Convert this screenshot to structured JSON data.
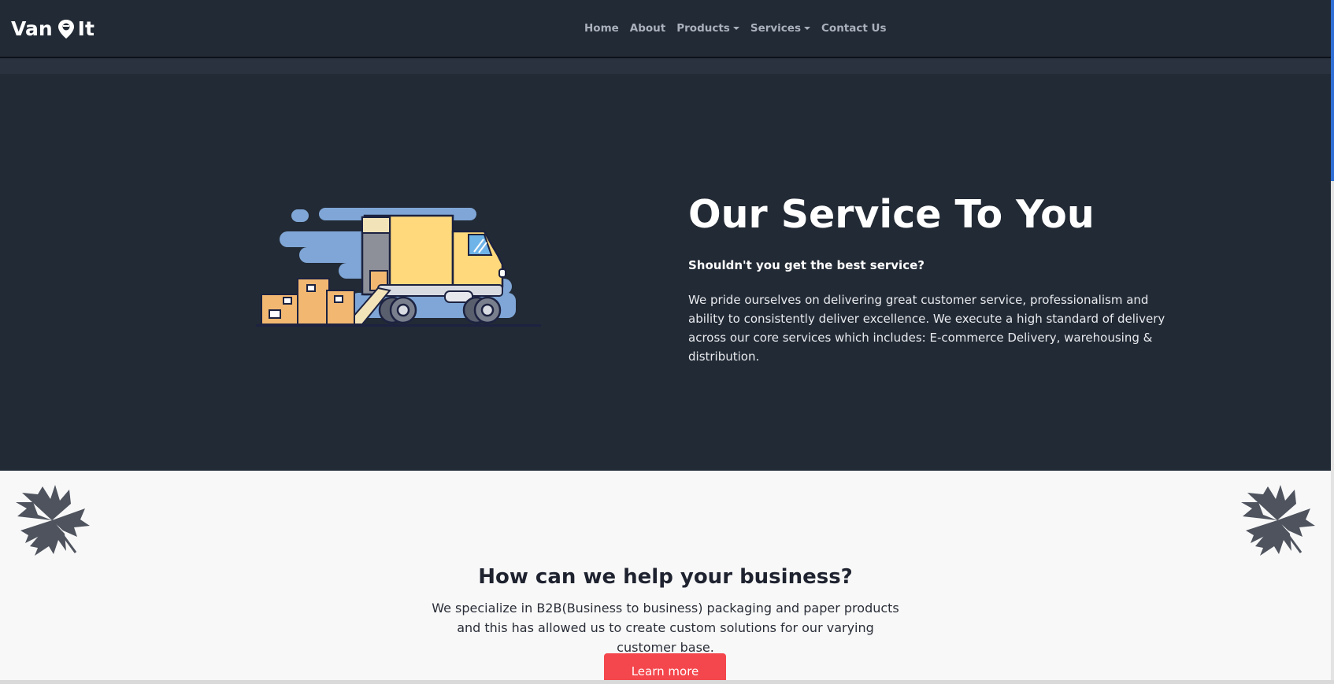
{
  "brand": {
    "name_left": "Van",
    "name_right": "It",
    "pin_icon": "map-pin-icon"
  },
  "nav": {
    "home": "Home",
    "about": "About",
    "products": "Products",
    "services": "Services",
    "contact": "Contact Us"
  },
  "hero": {
    "title": "Our Service To You",
    "subtitle": "Shouldn't you get the best service?",
    "body": "We pride ourselves on delivering great customer service, professionalism and ability to consistently deliver excellence. We execute a high standard of delivery across our core services which includes: E-commerce Delivery, warehousing & distribution.",
    "illustration": "delivery-truck-illustration"
  },
  "help": {
    "title": "How can we help your business?",
    "body": "We specialize in B2B(Business to business) packaging and paper products and this has allowed us to create custom solutions for our varying customer base.",
    "button": "Learn more"
  },
  "colors": {
    "navbar_bg": "#222a35",
    "hero_bg": "#222a35",
    "section_bg": "#f8f8f8",
    "accent": "#f4474d",
    "truck_yellow": "#ffd97c",
    "sky_blue": "#7fa6d6"
  }
}
